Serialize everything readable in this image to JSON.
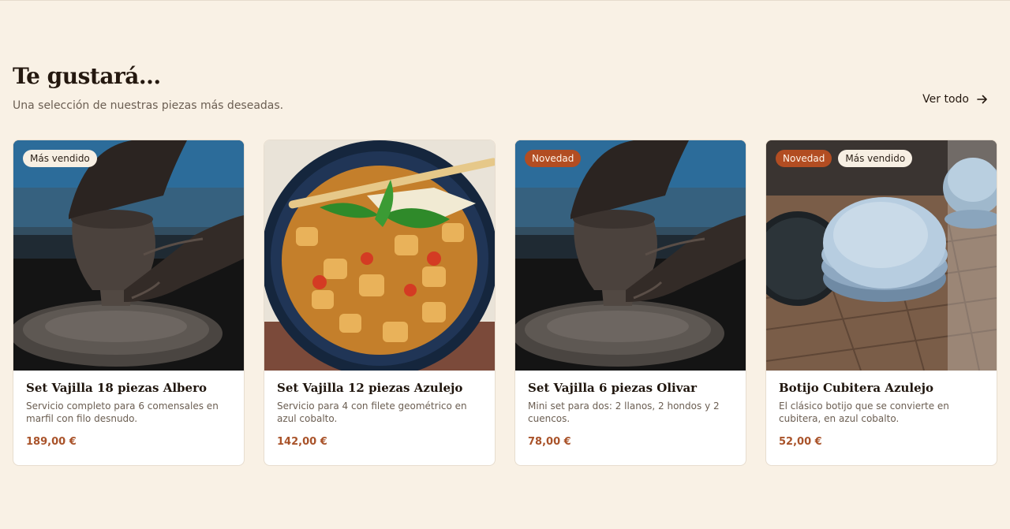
{
  "section": {
    "title": "Te gustará...",
    "subtitle": "Una selección de nuestras piezas más deseadas.",
    "view_all_label": "Ver todo"
  },
  "colors": {
    "background": "#f9f1e5",
    "accent": "#b24d22",
    "price": "#a9532a"
  },
  "products": [
    {
      "name": "Set Vajilla 18 piezas Albero",
      "description": "Servicio completo para 6 comensales en marfil con filo desnudo.",
      "price": "189,00 €",
      "badges": [
        "Más vendido"
      ],
      "image": "potter-wheel-photo"
    },
    {
      "name": "Set Vajilla 12 piezas Azulejo",
      "description": "Servicio para 4 con filete geométrico en azul cobalto.",
      "price": "142,00 €",
      "badges": [],
      "image": "stew-dish-photo"
    },
    {
      "name": "Set Vajilla 6 piezas Olivar",
      "description": "Mini set para dos: 2 llanos, 2 hondos y 2 cuencos.",
      "price": "78,00 €",
      "badges": [
        "Novedad"
      ],
      "image": "potter-wheel-photo"
    },
    {
      "name": "Botijo Cubitera Azulejo",
      "description": "El clásico botijo que se convierte en cubitera, en azul cobalto.",
      "price": "52,00 €",
      "badges": [
        "Novedad",
        "Más vendido"
      ],
      "image": "plates-stack-photo"
    }
  ]
}
